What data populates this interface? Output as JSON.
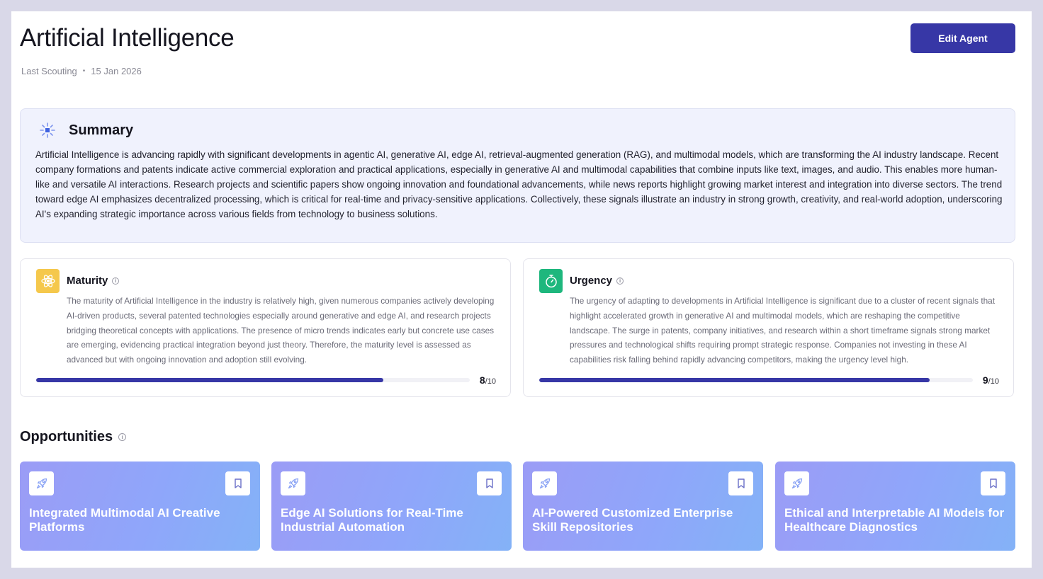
{
  "header": {
    "title": "Artificial Intelligence",
    "meta_label": "Last Scouting",
    "meta_separator": "•",
    "meta_date": "15 Jan 2026",
    "edit_button": "Edit Agent"
  },
  "summary": {
    "icon": "sparkle-burst-icon",
    "title": "Summary",
    "text": "Artificial Intelligence is advancing rapidly with significant developments in agentic AI, generative AI, edge AI, retrieval-augmented generation (RAG), and multimodal models, which are transforming the AI industry landscape. Recent company formations and patents indicate active commercial exploration and practical applications, especially in generative AI and multimodal capabilities that combine inputs like text, images, and audio. This enables more human-like and versatile AI interactions. Research projects and scientific papers show ongoing innovation and foundational advancements, while news reports highlight growing market interest and integration into diverse sectors. The trend toward edge AI emphasizes decentralized processing, which is critical for real-time and privacy-sensitive applications. Collectively, these signals illustrate an industry in strong growth, creativity, and real-world adoption, underscoring AI's expanding strategic importance across various fields from technology to business solutions."
  },
  "maturity": {
    "icon": "atom-icon",
    "icon_color": "#f5c84c",
    "title": "Maturity",
    "text": "The maturity of Artificial Intelligence in the industry is relatively high, given numerous companies actively developing AI-driven products, several patented technologies especially around generative and edge AI, and research projects bridging theoretical concepts with applications. The presence of micro trends indicates early but concrete use cases are emerging, evidencing practical integration beyond just theory. Therefore, the maturity level is assessed as advanced but with ongoing innovation and adoption still evolving.",
    "score": "8",
    "score_max": "/10",
    "fraction": 0.8
  },
  "urgency": {
    "icon": "stopwatch-icon",
    "icon_color": "#1eb77d",
    "title": "Urgency",
    "text": "The urgency of adapting to developments in Artificial Intelligence is significant due to a cluster of recent signals that highlight accelerated growth in generative AI and multimodal models, which are reshaping the competitive landscape. The surge in patents, company initiatives, and research within a short timeframe signals strong market pressures and technological shifts requiring prompt strategic response. Companies not investing in these AI capabilities risk falling behind rapidly advancing competitors, making the urgency level high.",
    "score": "9",
    "score_max": "/10",
    "fraction": 0.9
  },
  "opportunities": {
    "title": "Opportunities",
    "items": [
      {
        "title": "Integrated Multimodal AI Creative Platforms",
        "icon": "rocket-icon",
        "action_icon": "bookmark-icon"
      },
      {
        "title": "Edge AI Solutions for Real-Time Industrial Automation",
        "icon": "rocket-icon",
        "action_icon": "bookmark-icon"
      },
      {
        "title": "AI-Powered Customized Enterprise Skill Repositories",
        "icon": "rocket-icon",
        "action_icon": "bookmark-icon"
      },
      {
        "title": "Ethical and Interpretable AI Models for Healthcare Diagnostics",
        "icon": "rocket-icon",
        "action_icon": "bookmark-icon"
      }
    ]
  },
  "colors": {
    "accent": "#3737a6",
    "summary_bg": "#f0f2fd",
    "card_gradient_start": "#9b9cf6",
    "card_gradient_end": "#84b2f7"
  }
}
